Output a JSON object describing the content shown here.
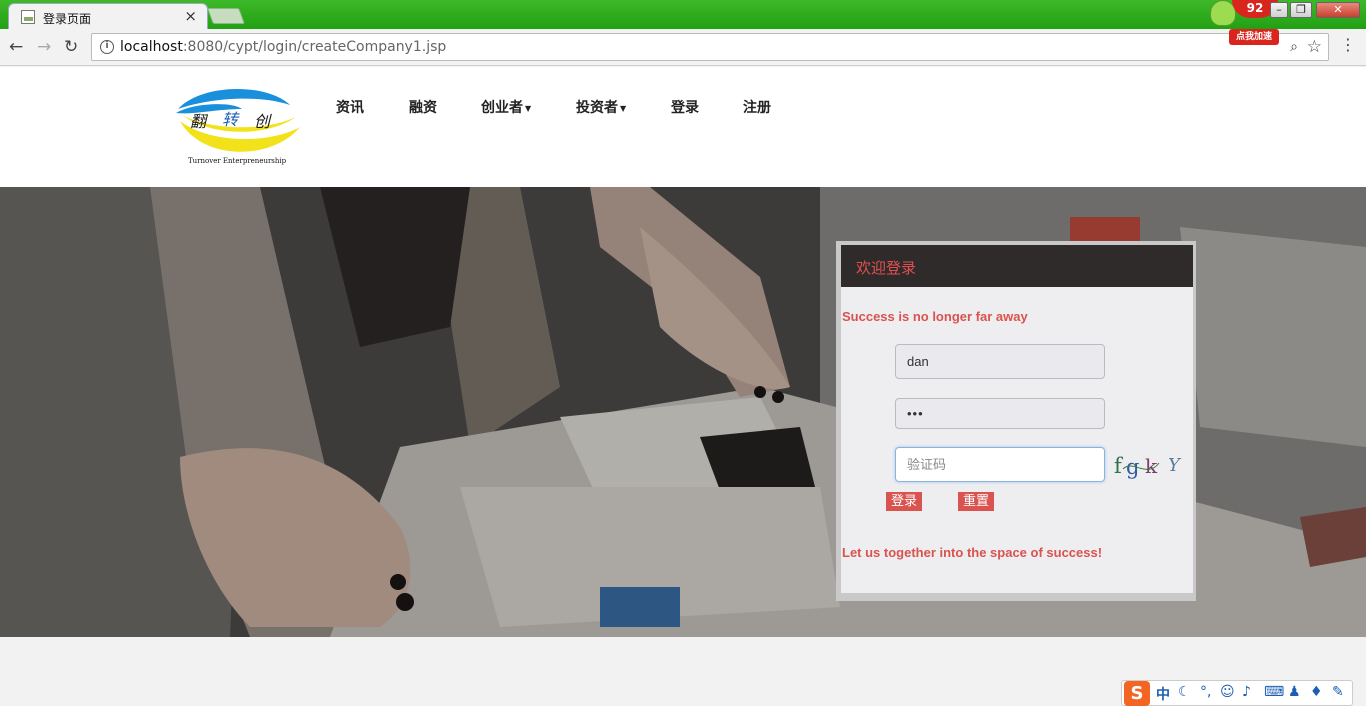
{
  "browser": {
    "tab_title": "登录页面",
    "tab_close": "×",
    "url_host": "localhost",
    "url_rest": ":8080/cypt/login/createCompany1.jsp",
    "badge_count": "92",
    "speed_tag": "点我加速",
    "icons": [
      "back-icon",
      "forward-icon",
      "reload-icon",
      "info-icon",
      "zoom-icon",
      "star-icon",
      "menu-icon"
    ]
  },
  "header": {
    "logo_tagline": "Turnover Enterpreneurship",
    "logo_text": [
      "翻",
      "转",
      "创"
    ],
    "nav": [
      {
        "label": "资讯"
      },
      {
        "label": "融资"
      },
      {
        "label": "创业者",
        "dropdown": true
      },
      {
        "label": "投资者",
        "dropdown": true
      },
      {
        "label": "登录"
      },
      {
        "label": "注册"
      }
    ]
  },
  "login": {
    "heading": "欢迎登录",
    "slogan_top": "Success is no longer far away",
    "username_value": "dan",
    "password_value": "•••",
    "captcha_placeholder": "验证码",
    "captcha_text": "fgkY",
    "login_button": "登录",
    "reset_button": "重置",
    "slogan_bottom": "Let us together into the space of success!"
  },
  "ime": {
    "logo": "S",
    "mode": "中"
  },
  "colors": {
    "accent": "#d9534f",
    "chrome_green": "#2ba41a",
    "panel_head": "#2f2b2a"
  }
}
